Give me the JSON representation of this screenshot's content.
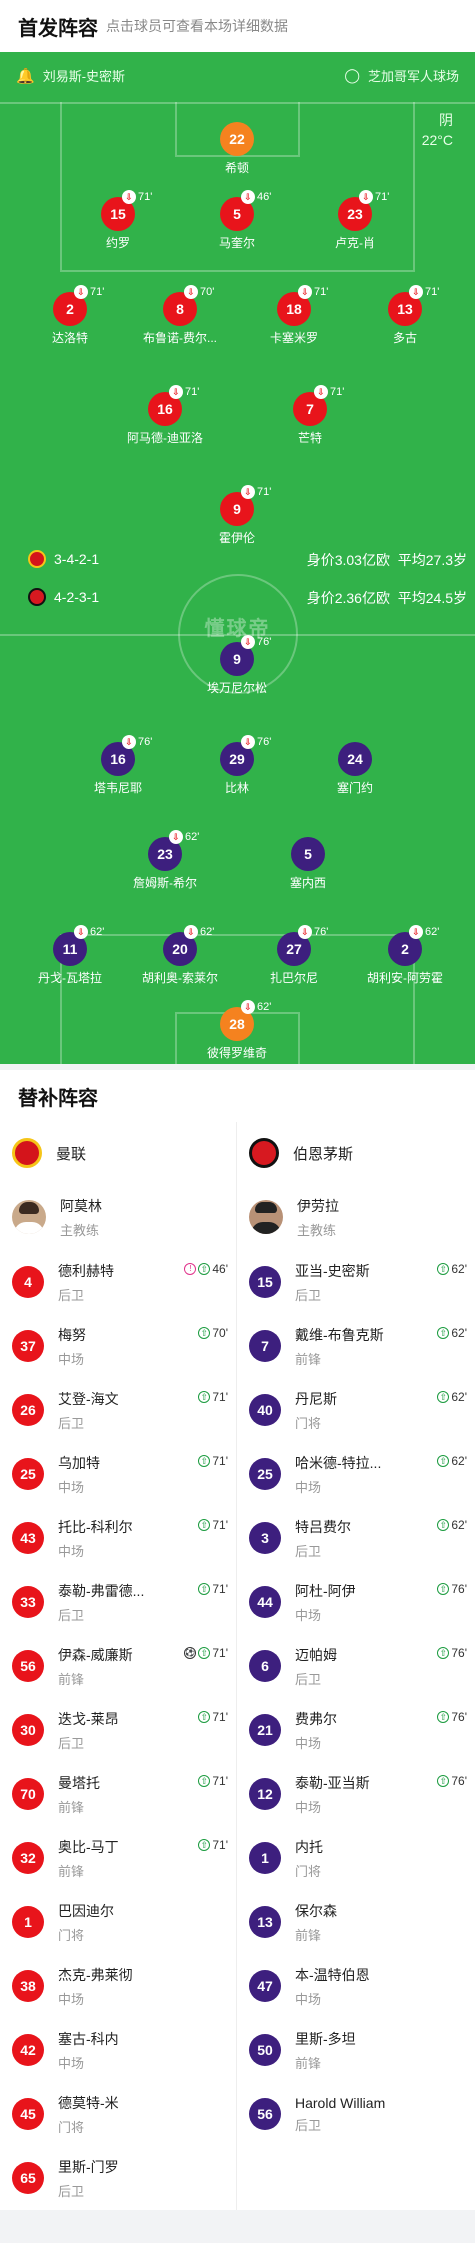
{
  "header": {
    "title": "首发阵容",
    "subtitle": "点击球员可查看本场详细数据"
  },
  "pitch_info": {
    "referee": "刘易斯-史密斯",
    "venue": "芝加哥军人球场",
    "weather": "阴",
    "temperature": "22°C"
  },
  "home_meta": {
    "formation": "3-4-2-1",
    "value": "身价3.03亿欧",
    "age": "平均27.3岁"
  },
  "away_meta": {
    "formation": "4-2-3-1",
    "value": "身价2.36亿欧",
    "age": "平均24.5岁"
  },
  "watermark": "懂球帝",
  "home_lineup": [
    {
      "n": "22",
      "name": "希顿",
      "sub": "",
      "gk": true
    },
    {
      "n": "15",
      "name": "约罗",
      "sub": "71'"
    },
    {
      "n": "5",
      "name": "马奎尔",
      "sub": "46'"
    },
    {
      "n": "23",
      "name": "卢克-肖",
      "sub": "71'"
    },
    {
      "n": "2",
      "name": "达洛特",
      "sub": "71'"
    },
    {
      "n": "8",
      "name": "布鲁诺-费尔...",
      "sub": "70'"
    },
    {
      "n": "18",
      "name": "卡塞米罗",
      "sub": "71'"
    },
    {
      "n": "13",
      "name": "多古",
      "sub": "71'",
      "ball": true,
      "assist": true
    },
    {
      "n": "16",
      "name": "阿马德-迪亚洛",
      "sub": "71'",
      "ball": true
    },
    {
      "n": "7",
      "name": "芒特",
      "sub": "71'",
      "assist": true
    },
    {
      "n": "9",
      "name": "霍伊伦",
      "sub": "71'",
      "ball": true
    }
  ],
  "away_lineup": [
    {
      "n": "9",
      "name": "埃万尼尔松",
      "sub": "76'"
    },
    {
      "n": "16",
      "name": "塔韦尼耶",
      "sub": "76'"
    },
    {
      "n": "29",
      "name": "比林",
      "sub": "76'"
    },
    {
      "n": "24",
      "name": "塞门约",
      "sub": ""
    },
    {
      "n": "23",
      "name": "詹姆斯-希尔",
      "sub": "62'"
    },
    {
      "n": "5",
      "name": "塞内西",
      "sub": ""
    },
    {
      "n": "11",
      "name": "丹戈-瓦塔拉",
      "sub": "62'"
    },
    {
      "n": "20",
      "name": "胡利奥-索莱尔",
      "sub": "62'"
    },
    {
      "n": "27",
      "name": "扎巴尔尼",
      "sub": "76'"
    },
    {
      "n": "2",
      "name": "胡利安-阿劳霍",
      "sub": "62'"
    },
    {
      "n": "28",
      "name": "彼得罗维奇",
      "sub": "62'",
      "gk": true
    }
  ],
  "subs_section": {
    "title": "替补阵容"
  },
  "home_team": {
    "name": "曼联",
    "coach": "阿莫林",
    "coach_role": "主教练"
  },
  "away_team": {
    "name": "伯恩茅斯",
    "coach": "伊劳拉",
    "coach_role": "主教练"
  },
  "home_subs": [
    {
      "n": "4",
      "name": "德利赫特",
      "pos": "后卫",
      "ev": "46'",
      "card": true
    },
    {
      "n": "37",
      "name": "梅努",
      "pos": "中场",
      "ev": "70'"
    },
    {
      "n": "26",
      "name": "艾登-海文",
      "pos": "后卫",
      "ev": "71'"
    },
    {
      "n": "25",
      "name": "乌加特",
      "pos": "中场",
      "ev": "71'"
    },
    {
      "n": "43",
      "name": "托比-科利尔",
      "pos": "中场",
      "ev": "71'"
    },
    {
      "n": "33",
      "name": "泰勒-弗雷德...",
      "pos": "后卫",
      "ev": "71'"
    },
    {
      "n": "56",
      "name": "伊森-威廉斯",
      "pos": "前锋",
      "ev": "71'",
      "ball": true
    },
    {
      "n": "30",
      "name": "迭戈-莱昂",
      "pos": "后卫",
      "ev": "71'"
    },
    {
      "n": "70",
      "name": "曼塔托",
      "pos": "前锋",
      "ev": "71'"
    },
    {
      "n": "32",
      "name": "奥比-马丁",
      "pos": "前锋",
      "ev": "71'"
    },
    {
      "n": "1",
      "name": "巴因迪尔",
      "pos": "门将",
      "ev": ""
    },
    {
      "n": "38",
      "name": "杰克-弗莱彻",
      "pos": "中场",
      "ev": ""
    },
    {
      "n": "42",
      "name": "塞古-科内",
      "pos": "中场",
      "ev": ""
    },
    {
      "n": "45",
      "name": "德莫特-米",
      "pos": "门将",
      "ev": ""
    },
    {
      "n": "65",
      "name": "里斯-门罗",
      "pos": "后卫",
      "ev": ""
    }
  ],
  "away_subs": [
    {
      "n": "15",
      "name": "亚当-史密斯",
      "pos": "后卫",
      "ev": "62'"
    },
    {
      "n": "7",
      "name": "戴维-布鲁克斯",
      "pos": "前锋",
      "ev": "62'"
    },
    {
      "n": "40",
      "name": "丹尼斯",
      "pos": "门将",
      "ev": "62'"
    },
    {
      "n": "25",
      "name": "哈米德-特拉...",
      "pos": "中场",
      "ev": "62'"
    },
    {
      "n": "3",
      "name": "特吕费尔",
      "pos": "后卫",
      "ev": "62'"
    },
    {
      "n": "44",
      "name": "阿杜-阿伊",
      "pos": "中场",
      "ev": "76'"
    },
    {
      "n": "6",
      "name": "迈帕姆",
      "pos": "后卫",
      "ev": "76'"
    },
    {
      "n": "21",
      "name": "费弗尔",
      "pos": "中场",
      "ev": "76'"
    },
    {
      "n": "12",
      "name": "泰勒-亚当斯",
      "pos": "中场",
      "ev": "76'"
    },
    {
      "n": "1",
      "name": "内托",
      "pos": "门将",
      "ev": ""
    },
    {
      "n": "13",
      "name": "保尔森",
      "pos": "前锋",
      "ev": ""
    },
    {
      "n": "47",
      "name": "本-温特伯恩",
      "pos": "中场",
      "ev": ""
    },
    {
      "n": "50",
      "name": "里斯-多坦",
      "pos": "前锋",
      "ev": ""
    },
    {
      "n": "56",
      "name": "Harold William",
      "pos": "后卫",
      "ev": ""
    }
  ],
  "colors": {
    "pitch": "#31b24a",
    "home": "#e8141b",
    "away": "#3d1f7e",
    "gk": "#f5821f"
  }
}
